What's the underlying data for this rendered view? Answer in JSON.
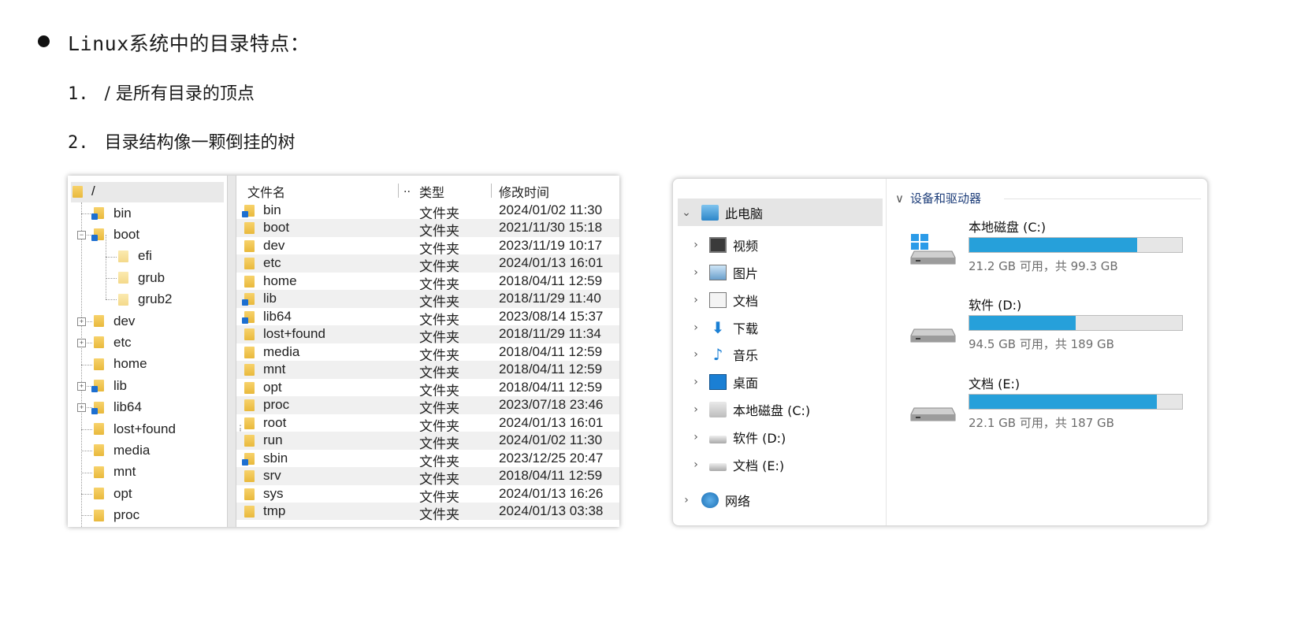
{
  "slide": {
    "heading_prefix": "Linux",
    "heading_rest": "系统中的目录特点：",
    "points": [
      {
        "num": "1.",
        "text": "/ 是所有目录的顶点"
      },
      {
        "num": "2.",
        "text": "目录结构像一颗倒挂的树"
      }
    ]
  },
  "linux": {
    "tree_root": "/",
    "tree": [
      {
        "label": "bin",
        "link": true,
        "expander": ""
      },
      {
        "label": "boot",
        "link": true,
        "expander": "−"
      },
      {
        "label": "efi",
        "link": false,
        "expander": "",
        "child": true
      },
      {
        "label": "grub",
        "link": false,
        "expander": "",
        "child": true
      },
      {
        "label": "grub2",
        "link": false,
        "expander": "",
        "child": true
      },
      {
        "label": "dev",
        "link": false,
        "expander": "+"
      },
      {
        "label": "etc",
        "link": false,
        "expander": "+"
      },
      {
        "label": "home",
        "link": false,
        "expander": ""
      },
      {
        "label": "lib",
        "link": true,
        "expander": "+"
      },
      {
        "label": "lib64",
        "link": true,
        "expander": "+"
      },
      {
        "label": "lost+found",
        "link": false,
        "expander": ""
      },
      {
        "label": "media",
        "link": false,
        "expander": ""
      },
      {
        "label": "mnt",
        "link": false,
        "expander": ""
      },
      {
        "label": "opt",
        "link": false,
        "expander": ""
      },
      {
        "label": "proc",
        "link": false,
        "expander": ""
      }
    ],
    "columns": {
      "name": "文件名",
      "ellipsis": "..",
      "type": "类型",
      "modified": "修改时间"
    },
    "files": [
      {
        "name": "bin",
        "type": "文件夹",
        "modified": "2024/01/02 11:30",
        "link": true
      },
      {
        "name": "boot",
        "type": "文件夹",
        "modified": "2021/11/30 15:18",
        "link": false
      },
      {
        "name": "dev",
        "type": "文件夹",
        "modified": "2023/11/19 10:17",
        "link": false
      },
      {
        "name": "etc",
        "type": "文件夹",
        "modified": "2024/01/13 16:01",
        "link": false
      },
      {
        "name": "home",
        "type": "文件夹",
        "modified": "2018/04/11 12:59",
        "link": false
      },
      {
        "name": "lib",
        "type": "文件夹",
        "modified": "2018/11/29 11:40",
        "link": true
      },
      {
        "name": "lib64",
        "type": "文件夹",
        "modified": "2023/08/14 15:37",
        "link": true
      },
      {
        "name": "lost+found",
        "type": "文件夹",
        "modified": "2018/11/29 11:34",
        "link": false
      },
      {
        "name": "media",
        "type": "文件夹",
        "modified": "2018/04/11 12:59",
        "link": false
      },
      {
        "name": "mnt",
        "type": "文件夹",
        "modified": "2018/04/11 12:59",
        "link": false
      },
      {
        "name": "opt",
        "type": "文件夹",
        "modified": "2018/04/11 12:59",
        "link": false
      },
      {
        "name": "proc",
        "type": "文件夹",
        "modified": "2023/07/18 23:46",
        "link": false
      },
      {
        "name": "root",
        "type": "文件夹",
        "modified": "2024/01/13 16:01",
        "link": false
      },
      {
        "name": "run",
        "type": "文件夹",
        "modified": "2024/01/02 11:30",
        "link": false
      },
      {
        "name": "sbin",
        "type": "文件夹",
        "modified": "2023/12/25 20:47",
        "link": true
      },
      {
        "name": "srv",
        "type": "文件夹",
        "modified": "2018/04/11 12:59",
        "link": false
      },
      {
        "name": "sys",
        "type": "文件夹",
        "modified": "2024/01/13 16:26",
        "link": false
      },
      {
        "name": "tmp",
        "type": "文件夹",
        "modified": "2024/01/13 03:38",
        "link": false
      }
    ]
  },
  "windows": {
    "nav": [
      {
        "label": "此电脑",
        "icon": "pc-icon",
        "chev": "⌄",
        "top": true
      },
      {
        "label": "视频",
        "icon": "video-icon",
        "chev": "›"
      },
      {
        "label": "图片",
        "icon": "pictures-icon",
        "chev": "›"
      },
      {
        "label": "文档",
        "icon": "documents-icon",
        "chev": "›"
      },
      {
        "label": "下载",
        "icon": "download-icon",
        "chev": "›"
      },
      {
        "label": "音乐",
        "icon": "music-icon",
        "chev": "›"
      },
      {
        "label": "桌面",
        "icon": "desktop-icon",
        "chev": "›"
      },
      {
        "label": "本地磁盘 (C:)",
        "icon": "windows-drive-icon",
        "chev": "›"
      },
      {
        "label": "软件 (D:)",
        "icon": "drive-icon",
        "chev": "›"
      },
      {
        "label": "文档 (E:)",
        "icon": "drive-icon",
        "chev": "›"
      },
      {
        "label": "网络",
        "icon": "network-icon",
        "chev": "›",
        "top": true
      }
    ],
    "section_title": "设备和驱动器",
    "section_chev": "∨",
    "drives": [
      {
        "name": "本地磁盘 (C:)",
        "free": "21.2 GB 可用，共 99.3 GB",
        "used_fraction": 0.79,
        "system": true
      },
      {
        "name": "软件 (D:)",
        "free": "94.5 GB 可用，共 189 GB",
        "used_fraction": 0.5,
        "system": false
      },
      {
        "name": "文档 (E:)",
        "free": "22.1 GB 可用，共 187 GB",
        "used_fraction": 0.88,
        "system": false
      }
    ],
    "bar_color": "#26a0da"
  }
}
